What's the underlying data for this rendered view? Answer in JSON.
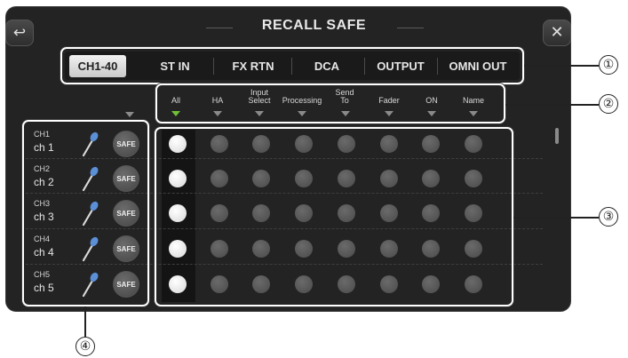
{
  "title": "RECALL SAFE",
  "back_icon": "↩",
  "close_icon": "✕",
  "tabs": [
    {
      "label": "CH1-40",
      "active": true
    },
    {
      "label": "ST IN",
      "active": false
    },
    {
      "label": "FX RTN",
      "active": false
    },
    {
      "label": "DCA",
      "active": false
    },
    {
      "label": "OUTPUT",
      "active": false
    },
    {
      "label": "OMNI OUT",
      "active": false
    }
  ],
  "columns": [
    {
      "label": "All",
      "selected": true
    },
    {
      "label": "HA",
      "selected": false
    },
    {
      "label": "Input\nSelect",
      "selected": false
    },
    {
      "label": "Processing",
      "selected": false
    },
    {
      "label": "Send\nTo",
      "selected": false
    },
    {
      "label": "Fader",
      "selected": false
    },
    {
      "label": "ON",
      "selected": false
    },
    {
      "label": "Name",
      "selected": false
    }
  ],
  "channels": [
    {
      "number": "CH1",
      "name": "ch 1",
      "safe_label": "SAFE"
    },
    {
      "number": "CH2",
      "name": "ch 2",
      "safe_label": "SAFE"
    },
    {
      "number": "CH3",
      "name": "ch 3",
      "safe_label": "SAFE"
    },
    {
      "number": "CH4",
      "name": "ch 4",
      "safe_label": "SAFE"
    },
    {
      "number": "CH5",
      "name": "ch 5",
      "safe_label": "SAFE"
    }
  ],
  "callouts": [
    "①",
    "②",
    "③",
    "④"
  ],
  "colors": {
    "panel": "#232323",
    "selected_triangle": "#6fbf3a",
    "dot_on": "#ffffff",
    "dot_off": "#555555"
  }
}
